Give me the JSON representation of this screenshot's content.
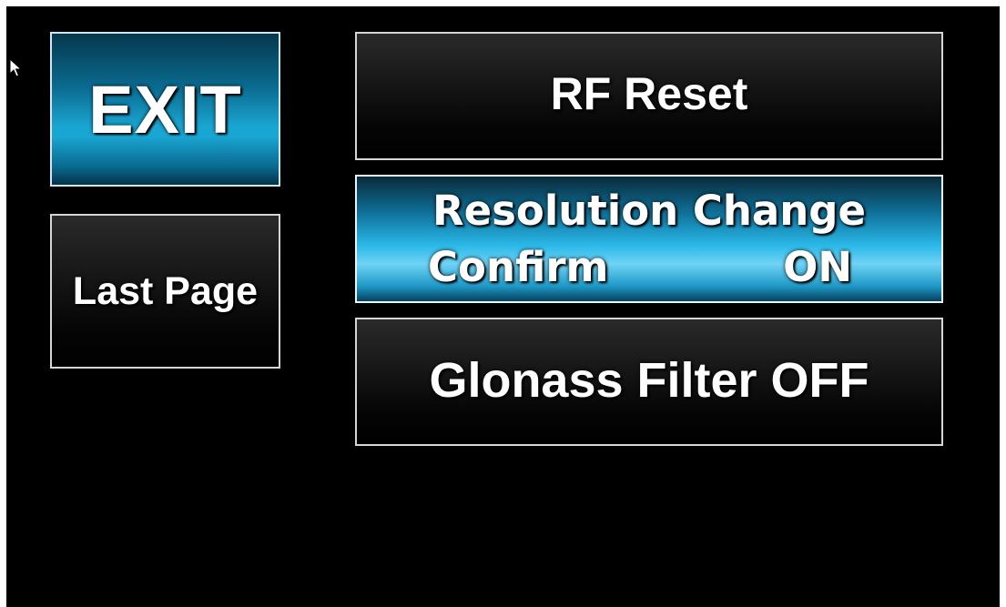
{
  "buttons": {
    "exit_label": "EXIT",
    "last_page_label": "Last Page",
    "rf_reset_label": "RF Reset",
    "resolution_change_label": "Resolution Change",
    "confirm_label": "Confirm",
    "confirm_state": "ON",
    "glonass_filter_label": "Glonass Filter OFF"
  },
  "colors": {
    "background": "#000000",
    "button_dark": "#1a1a1a",
    "button_accent": "#1aa6d3",
    "button_border": "#d6d6d6",
    "text": "#ffffff"
  },
  "icons": {
    "cursor": "mouse-pointer-icon"
  }
}
